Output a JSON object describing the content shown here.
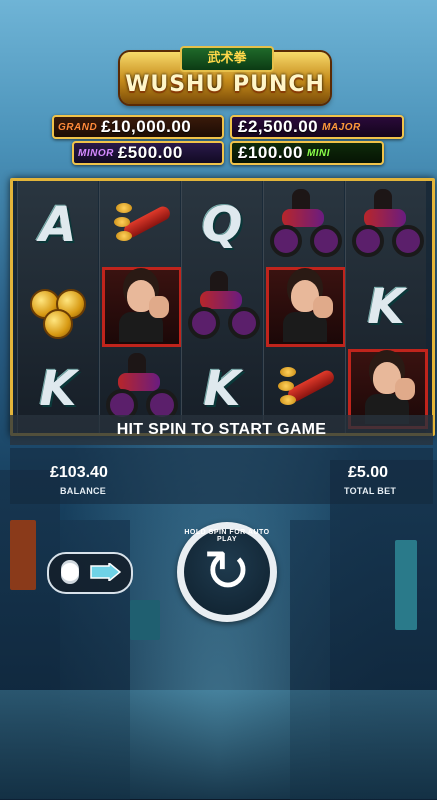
{
  "game": {
    "logo_chinese": "武术拳",
    "logo_title": "WUSHU PUNCH"
  },
  "jackpots": {
    "grand": {
      "label": "GRAND",
      "value": "£10,000.00"
    },
    "major": {
      "label": "MAJOR",
      "value": "£2,500.00"
    },
    "minor": {
      "label": "MINOR",
      "value": "£500.00"
    },
    "mini": {
      "label": "MINI",
      "value": "£100.00"
    }
  },
  "reels": [
    [
      "A",
      "coin-symbol",
      "K"
    ],
    [
      "firecracker-symbol",
      "fighter-woman-symbol",
      "motorbike-symbol"
    ],
    [
      "Q",
      "motorbike-symbol",
      "K"
    ],
    [
      "motorbike-symbol",
      "fighter-woman-symbol",
      "firecracker-symbol"
    ],
    [
      "motorbike-symbol",
      "K",
      "fighter-woman-symbol"
    ]
  ],
  "message": "HIT SPIN TO START GAME",
  "balance": {
    "value": "£103.40",
    "label": "BALANCE"
  },
  "total_bet": {
    "value": "£5.00",
    "label": "TOTAL BET"
  },
  "controls": {
    "spin_hint": "HOLD SPIN FOR AUTO PLAY",
    "spin_icon": "refresh-icon",
    "stake_icon": "coin-stack-icon"
  },
  "colors": {
    "frame_gold": "#e3b53a",
    "grand": "#b8471c",
    "major": "#7a2aa0",
    "minor": "#6a3aa0",
    "mini": "#3a8a1a"
  }
}
